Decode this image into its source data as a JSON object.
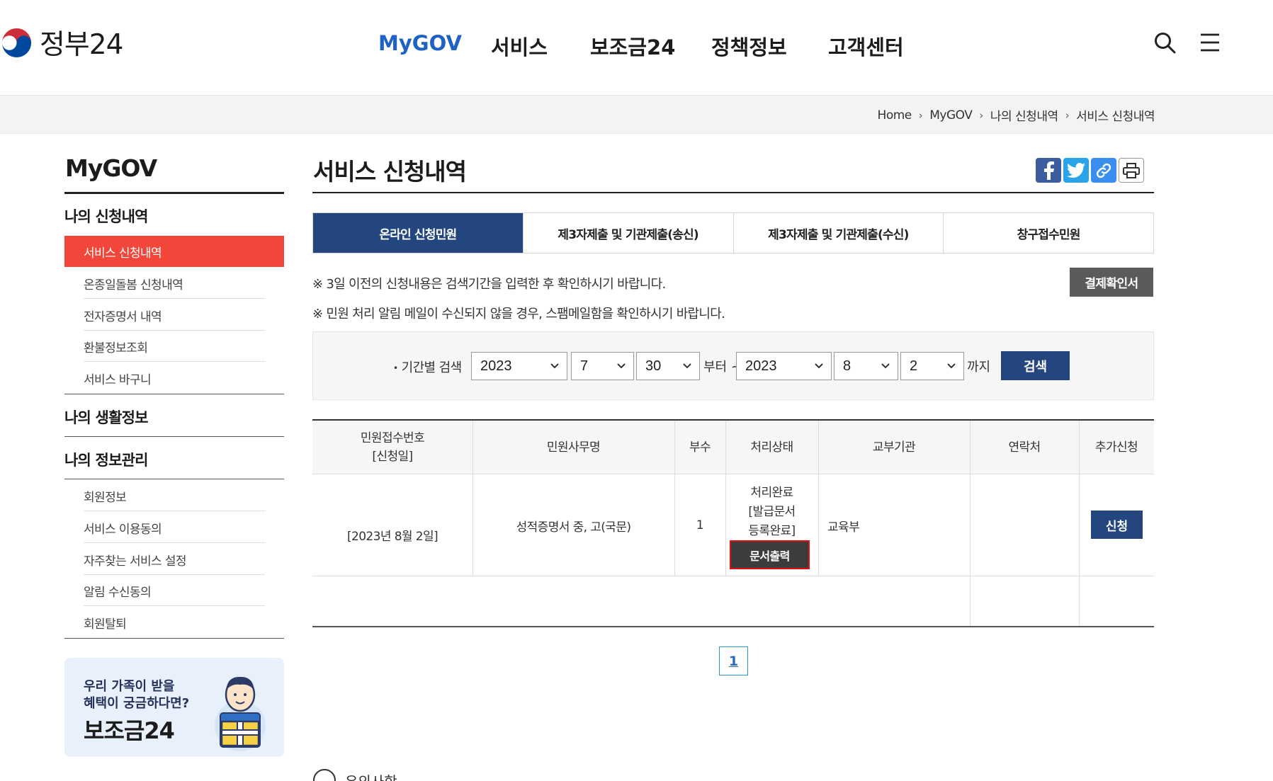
{
  "header": {
    "logo_text": "정부24",
    "nav": [
      "MyGOV",
      "서비스",
      "보조금24",
      "정책정보",
      "고객센터"
    ],
    "active_nav": "MyGOV"
  },
  "breadcrumb": [
    "Home",
    "MyGOV",
    "나의 신청내역",
    "서비스 신청내역"
  ],
  "sidebar": {
    "title": "MyGOV",
    "groups": [
      {
        "label": "나의 신청내역",
        "items": [
          "서비스 신청내역",
          "온종일돌봄 신청내역",
          "전자증명서 내역",
          "환불정보조회",
          "서비스 바구니"
        ]
      },
      {
        "label": "나의 생활정보",
        "items": []
      },
      {
        "label": "나의 정보관리",
        "items": [
          "회원정보",
          "서비스 이용동의",
          "자주찾는 서비스 설정",
          "알림 수신동의",
          "회원탈퇴"
        ]
      }
    ],
    "active_item": "서비스 신청내역",
    "banner": {
      "line1": "우리 가족이 받을",
      "line2": "혜택이 궁금하다면?",
      "title": "보조금24"
    }
  },
  "main": {
    "title": "서비스 신청내역",
    "tabs": [
      "온라인 신청민원",
      "제3자제출 및 기관제출(송신)",
      "제3자제출 및 기관제출(수신)",
      "창구접수민원"
    ],
    "active_tab": "온라인 신청민원",
    "notices": [
      "※ 3일 이전의 신청내용은 검색기간을 입력한 후 확인하시기 바랍니다.",
      "※ 민원 처리 알림 메일이 수신되지 않을 경우, 스팸메일함을 확인하시기 바랍니다."
    ],
    "receipt_button": "결제확인서",
    "search": {
      "label": "기간별 검색",
      "from_year": "2023",
      "from_month": "7",
      "from_day": "30",
      "from_suffix": "부터 ~",
      "to_year": "2023",
      "to_month": "8",
      "to_day": "2",
      "to_suffix": "까지",
      "button": "검색"
    },
    "table": {
      "headers": {
        "receipt_no_line1": "민원접수번호",
        "receipt_no_line2": "[신청일]",
        "name": "민원사무명",
        "copies": "부수",
        "status": "처리상태",
        "agency": "교부기관",
        "contact": "연락처",
        "extra": "추가신청"
      },
      "rows": [
        {
          "date": "[2023년 8월 2일]",
          "name": "성적증명서 중, 고(국문)",
          "copies": "1",
          "status_line1": "처리완료",
          "status_line2": "[발급문서",
          "status_line3": "등록완료]",
          "print_button": "문서출력",
          "agency": "교육부",
          "contact": "",
          "apply_button": "신청"
        }
      ]
    },
    "pagination": {
      "current": "1"
    },
    "caution_label": "유의사항"
  },
  "colors": {
    "primary": "#24467e",
    "active_nav": "#1f62c5",
    "sidebar_active": "#f2463b",
    "highlight_border": "#e01010"
  }
}
